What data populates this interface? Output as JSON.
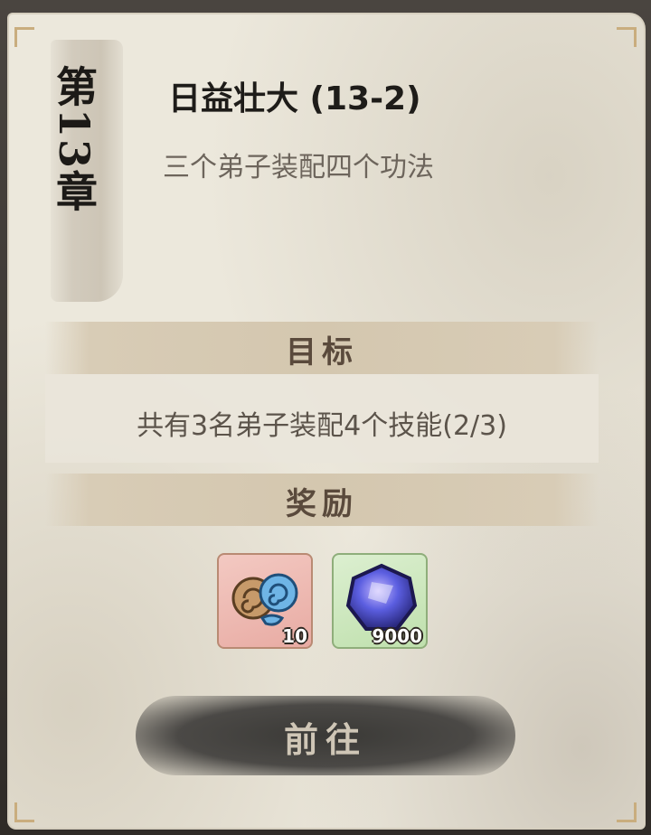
{
  "chapter": {
    "label": "第13章"
  },
  "quest": {
    "title": "日益壮大 (13-2)",
    "description": "三个弟子装配四个功法"
  },
  "objective": {
    "heading": "目标",
    "text": "共有3名弟子装配4个技能(2/3)"
  },
  "rewards": {
    "heading": "奖励",
    "items": [
      {
        "icon": "spirit-swirl-icon",
        "count": "10"
      },
      {
        "icon": "blue-gem-icon",
        "count": "9000"
      }
    ]
  },
  "actions": {
    "go_label": "前往"
  },
  "colors": {
    "paper": "#ece8dc",
    "band": "#d4c7af",
    "button": "#4b4946"
  }
}
